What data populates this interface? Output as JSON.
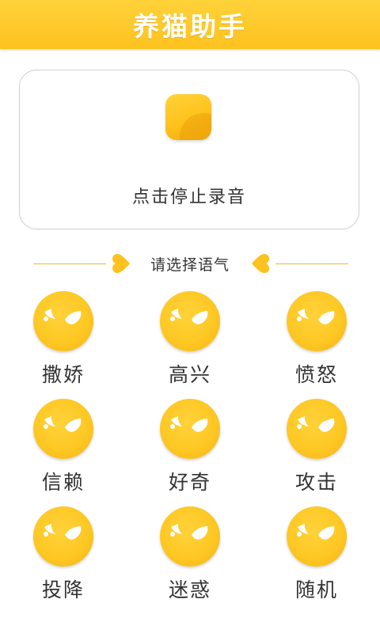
{
  "header": {
    "title": "养猫助手"
  },
  "recorder": {
    "stop_button_icon": "stop-square-icon",
    "hint": "点击停止录音",
    "accent_color": "#FFC21C"
  },
  "tone_section": {
    "label": "请选择语气",
    "heart_icon": "heart-icon",
    "tones": [
      {
        "label": "撒娇",
        "icon": "emoji-face-icon"
      },
      {
        "label": "高兴",
        "icon": "emoji-face-icon"
      },
      {
        "label": "愤怒",
        "icon": "emoji-face-icon"
      },
      {
        "label": "信赖",
        "icon": "emoji-face-icon"
      },
      {
        "label": "好奇",
        "icon": "emoji-face-icon"
      },
      {
        "label": "攻击",
        "icon": "emoji-face-icon"
      },
      {
        "label": "投降",
        "icon": "emoji-face-icon"
      },
      {
        "label": "迷惑",
        "icon": "emoji-face-icon"
      },
      {
        "label": "随机",
        "icon": "emoji-face-icon"
      }
    ]
  },
  "colors": {
    "header": "#FDC21F",
    "face": "#FEC824",
    "line": "#F2B62D"
  }
}
